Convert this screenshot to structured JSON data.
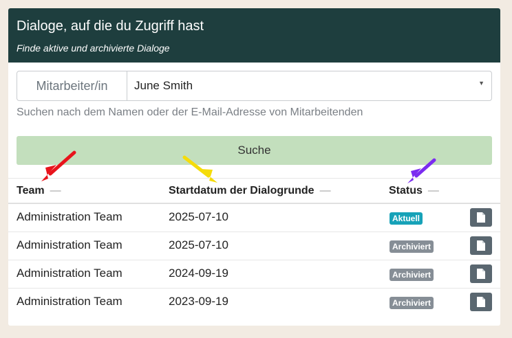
{
  "header": {
    "title": "Dialoge, auf die du Zugriff hast",
    "subtitle": "Finde aktive und archivierte Dialoge"
  },
  "filter": {
    "label": "Mitarbeiter/in",
    "selected_value": "June Smith",
    "hint": "Suchen nach dem Namen oder der E-Mail-Adresse von Mitarbeitenden"
  },
  "search_button": {
    "label": "Suche"
  },
  "table": {
    "columns": [
      {
        "label": "Team",
        "sort_indicator": "—"
      },
      {
        "label": "Startdatum der Dialogrunde",
        "sort_indicator": "—"
      },
      {
        "label": "Status",
        "sort_indicator": "—"
      }
    ],
    "rows": [
      {
        "team": "Administration Team",
        "start_date": "2025-07-10",
        "status": "Aktuell"
      },
      {
        "team": "Administration Team",
        "start_date": "2025-07-10",
        "status": "Archiviert"
      },
      {
        "team": "Administration Team",
        "start_date": "2024-09-19",
        "status": "Archiviert"
      },
      {
        "team": "Administration Team",
        "start_date": "2023-09-19",
        "status": "Archiviert"
      }
    ]
  },
  "colors": {
    "header_bg": "#1e3e3e",
    "search_button_bg": "#c3dfbd",
    "badge_current": "#17a2b8",
    "badge_archived": "#868e96",
    "arrow_team": "#e8141c",
    "arrow_date": "#f5dc0a",
    "arrow_status": "#7b2cf0"
  },
  "icons": {
    "document_button": "document-icon",
    "select_caret": "caret-down-icon",
    "annotation_arrows": "arrow-icon"
  }
}
